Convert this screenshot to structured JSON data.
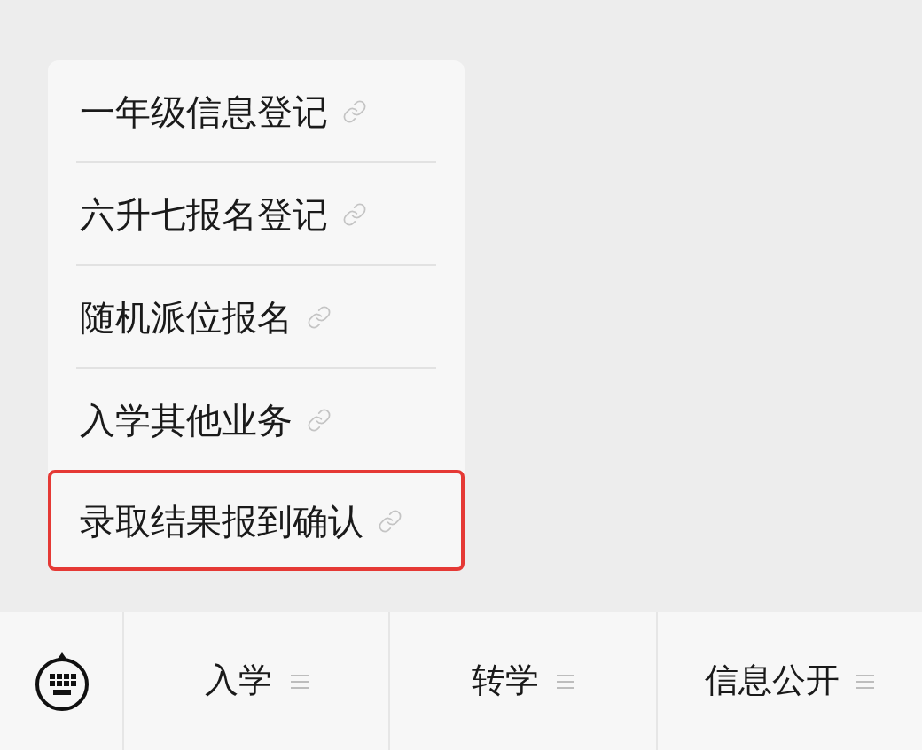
{
  "menu": {
    "items": [
      {
        "label": "一年级信息登记",
        "selected": false
      },
      {
        "label": "六升七报名登记",
        "selected": false
      },
      {
        "label": "随机派位报名",
        "selected": false
      },
      {
        "label": "入学其他业务",
        "selected": false
      },
      {
        "label": "录取结果报到确认",
        "selected": true
      }
    ]
  },
  "bottom_bar": {
    "tabs": [
      {
        "label": "入学"
      },
      {
        "label": "转学"
      },
      {
        "label": "信息公开"
      }
    ]
  }
}
